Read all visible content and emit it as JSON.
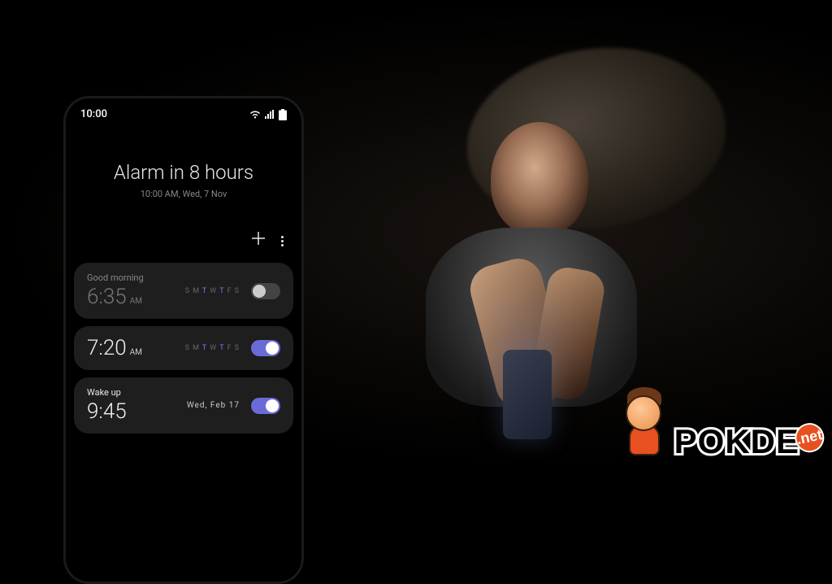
{
  "statusBar": {
    "time": "10:00"
  },
  "header": {
    "title": "Alarm in 8 hours",
    "subtitle": "10:00 AM, Wed, 7 Nov"
  },
  "dayLetters": [
    "S",
    "M",
    "T",
    "W",
    "T",
    "F",
    "S"
  ],
  "alarms": [
    {
      "label": "Good morning",
      "time": "6:35",
      "meridiem": "AM",
      "enabled": false,
      "activeDays": [
        2,
        4
      ]
    },
    {
      "label": "",
      "time": "7:20",
      "meridiem": "AM",
      "enabled": true,
      "activeDays": [
        2,
        4
      ]
    },
    {
      "label": "Wake up",
      "time": "9:45",
      "meridiem": "",
      "enabled": true,
      "dateText": "Wed, Feb 17"
    }
  ],
  "watermark": {
    "brand": "POKDE",
    "suffix": ".net"
  }
}
